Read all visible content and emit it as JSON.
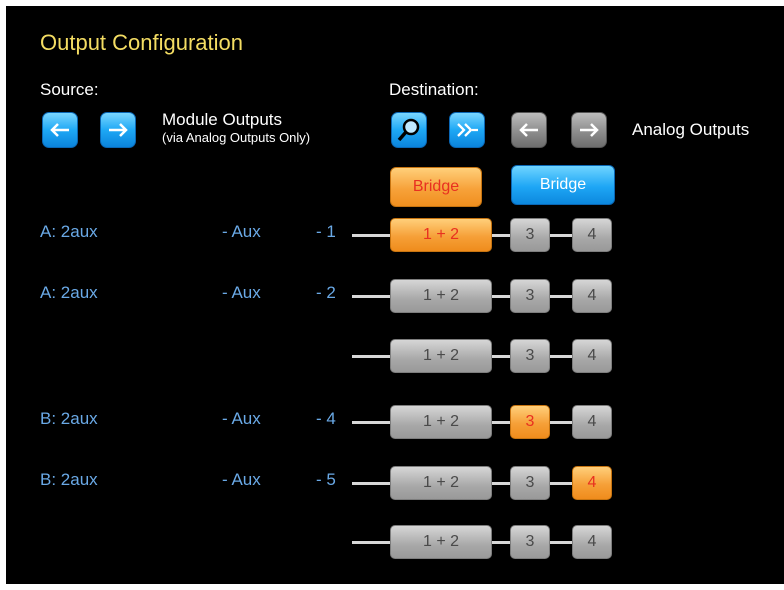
{
  "title": "Output Configuration",
  "source": {
    "label": "Source:",
    "left_icon": "arrow-left-icon",
    "right_icon": "arrow-right-icon",
    "module_outputs": "Module Outputs",
    "module_outputs_note": "(via Analog Outputs Only)"
  },
  "destination": {
    "label": "Destination:",
    "search_icon": "magnifier-icon",
    "fast_forward_icon": "double-arrow-right-icon",
    "left_icon": "arrow-left-icon",
    "right_icon": "arrow-right-icon",
    "analog_outputs": "Analog Outputs"
  },
  "bridges": {
    "left": {
      "label": "Bridge",
      "color": "#f7a23a"
    },
    "right": {
      "label": "Bridge",
      "color": "#1ea6f5"
    }
  },
  "rows": [
    {
      "module": "A: 2aux",
      "aux": "- Aux",
      "num": "- 1",
      "b12": "1 + 2",
      "b3": "3",
      "b4": "4",
      "active": "12"
    },
    {
      "module": "A: 2aux",
      "aux": "- Aux",
      "num": "- 2",
      "b12": "1 + 2",
      "b3": "3",
      "b4": "4",
      "active": ""
    },
    {
      "module": "",
      "aux": "",
      "num": "",
      "b12": "1 + 2",
      "b3": "3",
      "b4": "4",
      "active": ""
    },
    {
      "module": "B: 2aux",
      "aux": "- Aux",
      "num": "- 4",
      "b12": "1 + 2",
      "b3": "3",
      "b4": "4",
      "active": "3"
    },
    {
      "module": "B: 2aux",
      "aux": "- Aux",
      "num": "- 5",
      "b12": "1 + 2",
      "b3": "3",
      "b4": "4",
      "active": "4"
    },
    {
      "module": "",
      "aux": "",
      "num": "",
      "b12": "1 + 2",
      "b3": "3",
      "b4": "4",
      "active": ""
    }
  ],
  "colors": {
    "active": "#f6a038",
    "inactive": "#a8a8a8",
    "title": "#f4dd63",
    "row_text": "#6aa9e6"
  }
}
